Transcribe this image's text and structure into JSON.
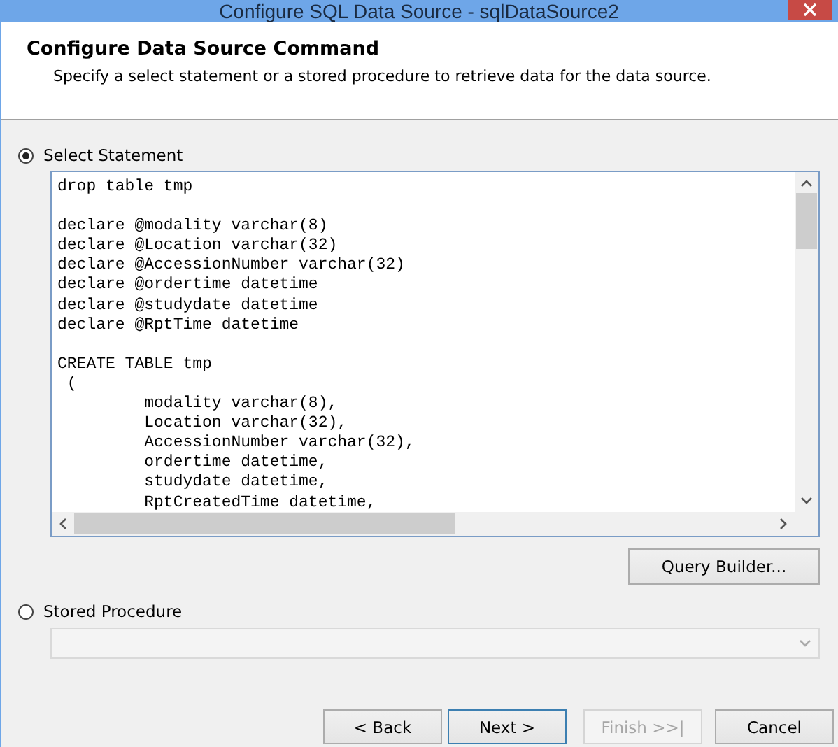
{
  "window": {
    "title": "Configure SQL Data Source - sqlDataSource2"
  },
  "header": {
    "title": "Configure Data Source Command",
    "description": "Specify a select statement or a stored procedure to retrieve data for the data source."
  },
  "options": [
    {
      "label": "Select Statement",
      "selected": true
    },
    {
      "label": "Stored Procedure",
      "selected": false
    }
  ],
  "sql_editor": {
    "text": "drop table tmp\n\ndeclare @modality varchar(8)\ndeclare @Location varchar(32)\ndeclare @AccessionNumber varchar(32)\ndeclare @ordertime datetime\ndeclare @studydate datetime\ndeclare @RptTime datetime\n\nCREATE TABLE tmp\n (\n         modality varchar(8),\n         Location varchar(32),\n         AccessionNumber varchar(32),\n         ordertime datetime,\n         studydate datetime,\n         RptCreatedTime datetime,"
  },
  "query_builder_button": "Query Builder...",
  "stored_procedure_dropdown": {
    "disabled": true
  },
  "buttons": [
    {
      "label": "< Back",
      "default": false,
      "disabled": false
    },
    {
      "label": "Next >",
      "default": true,
      "disabled": false
    },
    {
      "label": "Finish >>|",
      "default": false,
      "disabled": true
    },
    {
      "label": "Cancel",
      "default": false,
      "disabled": false
    }
  ]
}
